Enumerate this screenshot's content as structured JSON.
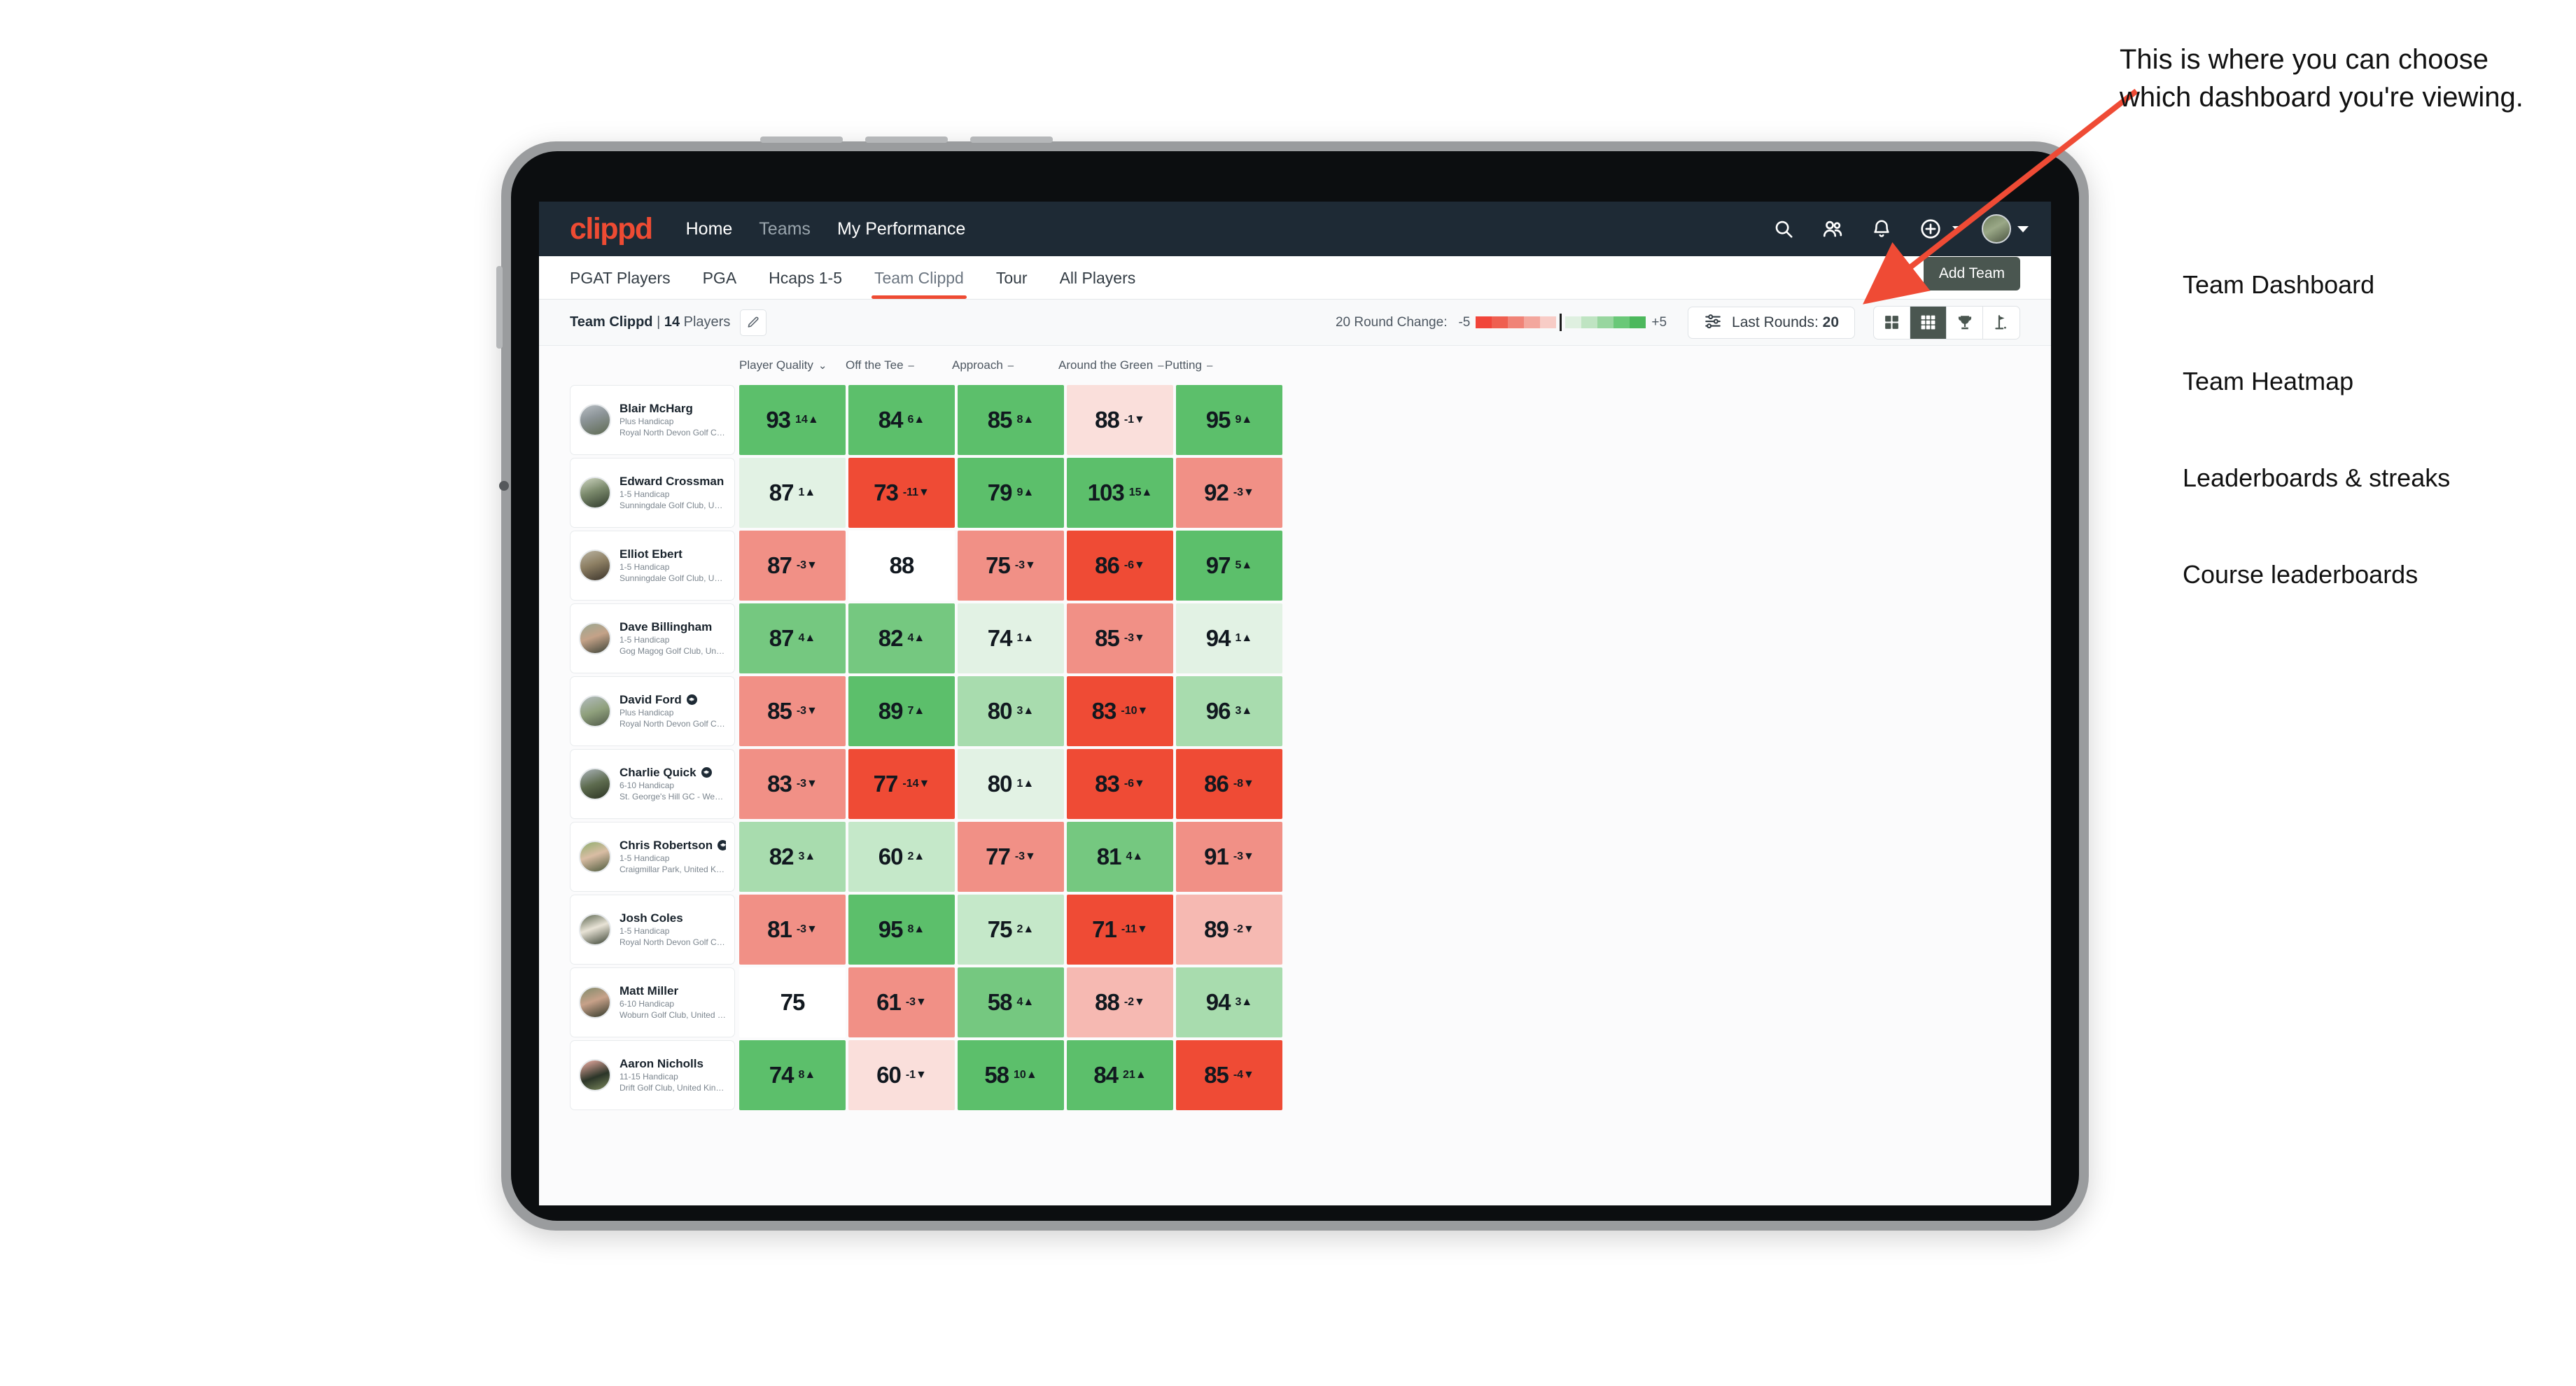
{
  "brand": {
    "logo": "clippd",
    "accent": "#ee4b33",
    "navbar_bg": "#1e2a35"
  },
  "topnav": {
    "links": [
      {
        "label": "Home",
        "state": "active"
      },
      {
        "label": "Teams",
        "state": "dim"
      },
      {
        "label": "My Performance",
        "state": "active"
      }
    ],
    "icons": [
      "search-icon",
      "people-icon",
      "bell-icon",
      "plus-circle-icon",
      "avatar"
    ]
  },
  "tabs": [
    {
      "label": "PGAT Players",
      "active": false
    },
    {
      "label": "PGA",
      "active": false
    },
    {
      "label": "Hcaps 1-5",
      "active": false
    },
    {
      "label": "Team Clippd",
      "active": true
    },
    {
      "label": "Tour",
      "active": false
    },
    {
      "label": "All Players",
      "active": false
    }
  ],
  "add_team_button": "Add Team",
  "controlbar": {
    "team_name": "Team Clippd",
    "team_separator": " | ",
    "player_count": "14",
    "players_word": " Players",
    "edit_icon": "pencil-icon",
    "legend_label": "20 Round Change:",
    "legend_min": "-5",
    "legend_max": "+5",
    "legend_colors": [
      "#f1453a",
      "#ef5f50",
      "#f08377",
      "#f3a79d",
      "#f8ccc6",
      "#dff0e0",
      "#bfe4c2",
      "#98d69f",
      "#6ac878",
      "#4cb85c"
    ],
    "rounds_button": {
      "icon": "filter-sliders-icon",
      "label": "Last Rounds:",
      "value": "20"
    },
    "view_toggles": [
      {
        "icon": "grid-2x2-icon",
        "name": "team-dashboard",
        "active": false
      },
      {
        "icon": "grid-3x3-icon",
        "name": "team-heatmap",
        "active": true
      },
      {
        "icon": "trophy-icon",
        "name": "leaderboards-streaks",
        "active": false
      },
      {
        "icon": "golf-flag-icon",
        "name": "course-leaderboards",
        "active": false
      }
    ]
  },
  "table": {
    "columns": [
      {
        "label": "Player Quality",
        "marker": "chevron-down"
      },
      {
        "label": "Off the Tee",
        "marker": "dash"
      },
      {
        "label": "Approach",
        "marker": "dash"
      },
      {
        "label": "Around the Green",
        "marker": "dash"
      },
      {
        "label": "Putting",
        "marker": "dash"
      }
    ],
    "rows": [
      {
        "name": "Blair McHarg",
        "verified": false,
        "handicap": "Plus Handicap",
        "club": "Royal North Devon Golf Club, United Kingdom",
        "avatar": "linear-gradient(160deg,#b9bfc4 0%,#8d9599 40%,#5e6a52 100%)",
        "cells": [
          {
            "value": "93",
            "delta": "14",
            "dir": "up",
            "bg": "#5cbf6b"
          },
          {
            "value": "84",
            "delta": "6",
            "dir": "up",
            "bg": "#5cbf6b"
          },
          {
            "value": "85",
            "delta": "8",
            "dir": "up",
            "bg": "#5cbf6b"
          },
          {
            "value": "88",
            "delta": "-1",
            "dir": "down",
            "bg": "#fadfdb"
          },
          {
            "value": "95",
            "delta": "9",
            "dir": "up",
            "bg": "#5cbf6b"
          }
        ]
      },
      {
        "name": "Edward Crossman",
        "verified": false,
        "handicap": "1-5 Handicap",
        "club": "Sunningdale Golf Club, United Kingdom",
        "avatar": "linear-gradient(160deg,#cfd6c2 0%,#7b8a6c 45%,#2f3a2b 100%)",
        "cells": [
          {
            "value": "87",
            "delta": "1",
            "dir": "up",
            "bg": "#e2f2e4"
          },
          {
            "value": "73",
            "delta": "-11",
            "dir": "down",
            "bg": "#ef4b35"
          },
          {
            "value": "79",
            "delta": "9",
            "dir": "up",
            "bg": "#5cbf6b"
          },
          {
            "value": "103",
            "delta": "15",
            "dir": "up",
            "bg": "#5cbf6b"
          },
          {
            "value": "92",
            "delta": "-3",
            "dir": "down",
            "bg": "#f19086"
          }
        ]
      },
      {
        "name": "Elliot Ebert",
        "verified": false,
        "handicap": "1-5 Handicap",
        "club": "Sunningdale Golf Club, United Kingdom",
        "avatar": "linear-gradient(160deg,#b9b3a2 0%,#8d7f63 45%,#3a332a 100%)",
        "cells": [
          {
            "value": "87",
            "delta": "-3",
            "dir": "down",
            "bg": "#f19086"
          },
          {
            "value": "88",
            "delta": "",
            "dir": "",
            "bg": "#ffffff"
          },
          {
            "value": "75",
            "delta": "-3",
            "dir": "down",
            "bg": "#f19086"
          },
          {
            "value": "86",
            "delta": "-6",
            "dir": "down",
            "bg": "#ef4b35"
          },
          {
            "value": "97",
            "delta": "5",
            "dir": "up",
            "bg": "#5cbf6b"
          }
        ]
      },
      {
        "name": "Dave Billingham",
        "verified": false,
        "handicap": "1-5 Handicap",
        "club": "Gog Magog Golf Club, United Kingdom",
        "avatar": "linear-gradient(160deg,#9aa892 0%,#c4a288 45%,#3d4438 100%)",
        "cells": [
          {
            "value": "87",
            "delta": "4",
            "dir": "up",
            "bg": "#75c880"
          },
          {
            "value": "82",
            "delta": "4",
            "dir": "up",
            "bg": "#75c880"
          },
          {
            "value": "74",
            "delta": "1",
            "dir": "up",
            "bg": "#e2f2e4"
          },
          {
            "value": "85",
            "delta": "-3",
            "dir": "down",
            "bg": "#f19086"
          },
          {
            "value": "94",
            "delta": "1",
            "dir": "up",
            "bg": "#e2f2e4"
          }
        ]
      },
      {
        "name": "David Ford",
        "verified": true,
        "handicap": "Plus Handicap",
        "club": "Royal North Devon Golf Club, United Kingdom",
        "avatar": "linear-gradient(160deg,#b3bcc0 0%,#8fa07c 50%,#505a49 100%)",
        "cells": [
          {
            "value": "85",
            "delta": "-3",
            "dir": "down",
            "bg": "#f19086"
          },
          {
            "value": "89",
            "delta": "7",
            "dir": "up",
            "bg": "#5cbf6b"
          },
          {
            "value": "80",
            "delta": "3",
            "dir": "up",
            "bg": "#a8dcae"
          },
          {
            "value": "83",
            "delta": "-10",
            "dir": "down",
            "bg": "#ef4b35"
          },
          {
            "value": "96",
            "delta": "3",
            "dir": "up",
            "bg": "#a8dcae"
          }
        ]
      },
      {
        "name": "Charlie Quick",
        "verified": true,
        "handicap": "6-10 Handicap",
        "club": "St. George's Hill GC - Weybridge - Surrey, Uni...",
        "avatar": "linear-gradient(160deg,#aab3b8 0%,#5d6b4e 50%,#2c3424 100%)",
        "cells": [
          {
            "value": "83",
            "delta": "-3",
            "dir": "down",
            "bg": "#f19086"
          },
          {
            "value": "77",
            "delta": "-14",
            "dir": "down",
            "bg": "#ef4b35"
          },
          {
            "value": "80",
            "delta": "1",
            "dir": "up",
            "bg": "#e2f2e4"
          },
          {
            "value": "83",
            "delta": "-6",
            "dir": "down",
            "bg": "#ef4b35"
          },
          {
            "value": "86",
            "delta": "-8",
            "dir": "down",
            "bg": "#ef4b35"
          }
        ]
      },
      {
        "name": "Chris Robertson",
        "verified": true,
        "handicap": "1-5 Handicap",
        "club": "Craigmillar Park, United Kingdom",
        "avatar": "linear-gradient(160deg,#8fae6e 0%,#d9bda4 45%,#4c5a3c 100%)",
        "cells": [
          {
            "value": "82",
            "delta": "3",
            "dir": "up",
            "bg": "#a8dcae"
          },
          {
            "value": "60",
            "delta": "2",
            "dir": "up",
            "bg": "#c5e8c9"
          },
          {
            "value": "77",
            "delta": "-3",
            "dir": "down",
            "bg": "#f19086"
          },
          {
            "value": "81",
            "delta": "4",
            "dir": "up",
            "bg": "#75c880"
          },
          {
            "value": "91",
            "delta": "-3",
            "dir": "down",
            "bg": "#f19086"
          }
        ]
      },
      {
        "name": "Josh Coles",
        "verified": false,
        "handicap": "1-5 Handicap",
        "club": "Royal North Devon Golf Club, United Kingdom",
        "avatar": "linear-gradient(160deg,#5c6650 0%,#e8e3d6 45%,#3a4233 100%)",
        "cells": [
          {
            "value": "81",
            "delta": "-3",
            "dir": "down",
            "bg": "#f19086"
          },
          {
            "value": "95",
            "delta": "8",
            "dir": "up",
            "bg": "#5cbf6b"
          },
          {
            "value": "75",
            "delta": "2",
            "dir": "up",
            "bg": "#c5e8c9"
          },
          {
            "value": "71",
            "delta": "-11",
            "dir": "down",
            "bg": "#ef4b35"
          },
          {
            "value": "89",
            "delta": "-2",
            "dir": "down",
            "bg": "#f6b9b2"
          }
        ]
      },
      {
        "name": "Matt Miller",
        "verified": false,
        "handicap": "6-10 Handicap",
        "club": "Woburn Golf Club, United Kingdom",
        "avatar": "linear-gradient(160deg,#7f8a6a 0%,#c7a189 45%,#32392a 100%)",
        "cells": [
          {
            "value": "75",
            "delta": "",
            "dir": "",
            "bg": "#ffffff"
          },
          {
            "value": "61",
            "delta": "-3",
            "dir": "down",
            "bg": "#f19086"
          },
          {
            "value": "58",
            "delta": "4",
            "dir": "up",
            "bg": "#75c880"
          },
          {
            "value": "88",
            "delta": "-2",
            "dir": "down",
            "bg": "#f6b9b2"
          },
          {
            "value": "94",
            "delta": "3",
            "dir": "up",
            "bg": "#a8dcae"
          }
        ]
      },
      {
        "name": "Aaron Nicholls",
        "verified": false,
        "handicap": "11-15 Handicap",
        "club": "Drift Golf Club, United Kingdom",
        "avatar": "linear-gradient(160deg,#f2b0a6 0%,#2b3528 55%,#7d8a5e 100%)",
        "cells": [
          {
            "value": "74",
            "delta": "8",
            "dir": "up",
            "bg": "#5cbf6b"
          },
          {
            "value": "60",
            "delta": "-1",
            "dir": "down",
            "bg": "#fadfdb"
          },
          {
            "value": "58",
            "delta": "10",
            "dir": "up",
            "bg": "#5cbf6b"
          },
          {
            "value": "84",
            "delta": "21",
            "dir": "up",
            "bg": "#5cbf6b"
          },
          {
            "value": "85",
            "delta": "-4",
            "dir": "down",
            "bg": "#ef4b35"
          }
        ]
      }
    ]
  },
  "annotation": {
    "callout": "This is where you can choose which dashboard you're viewing.",
    "arrow_color": "#ef4b35",
    "items": [
      "Team Dashboard",
      "Team Heatmap",
      "Leaderboards & streaks",
      "Course leaderboards"
    ]
  }
}
